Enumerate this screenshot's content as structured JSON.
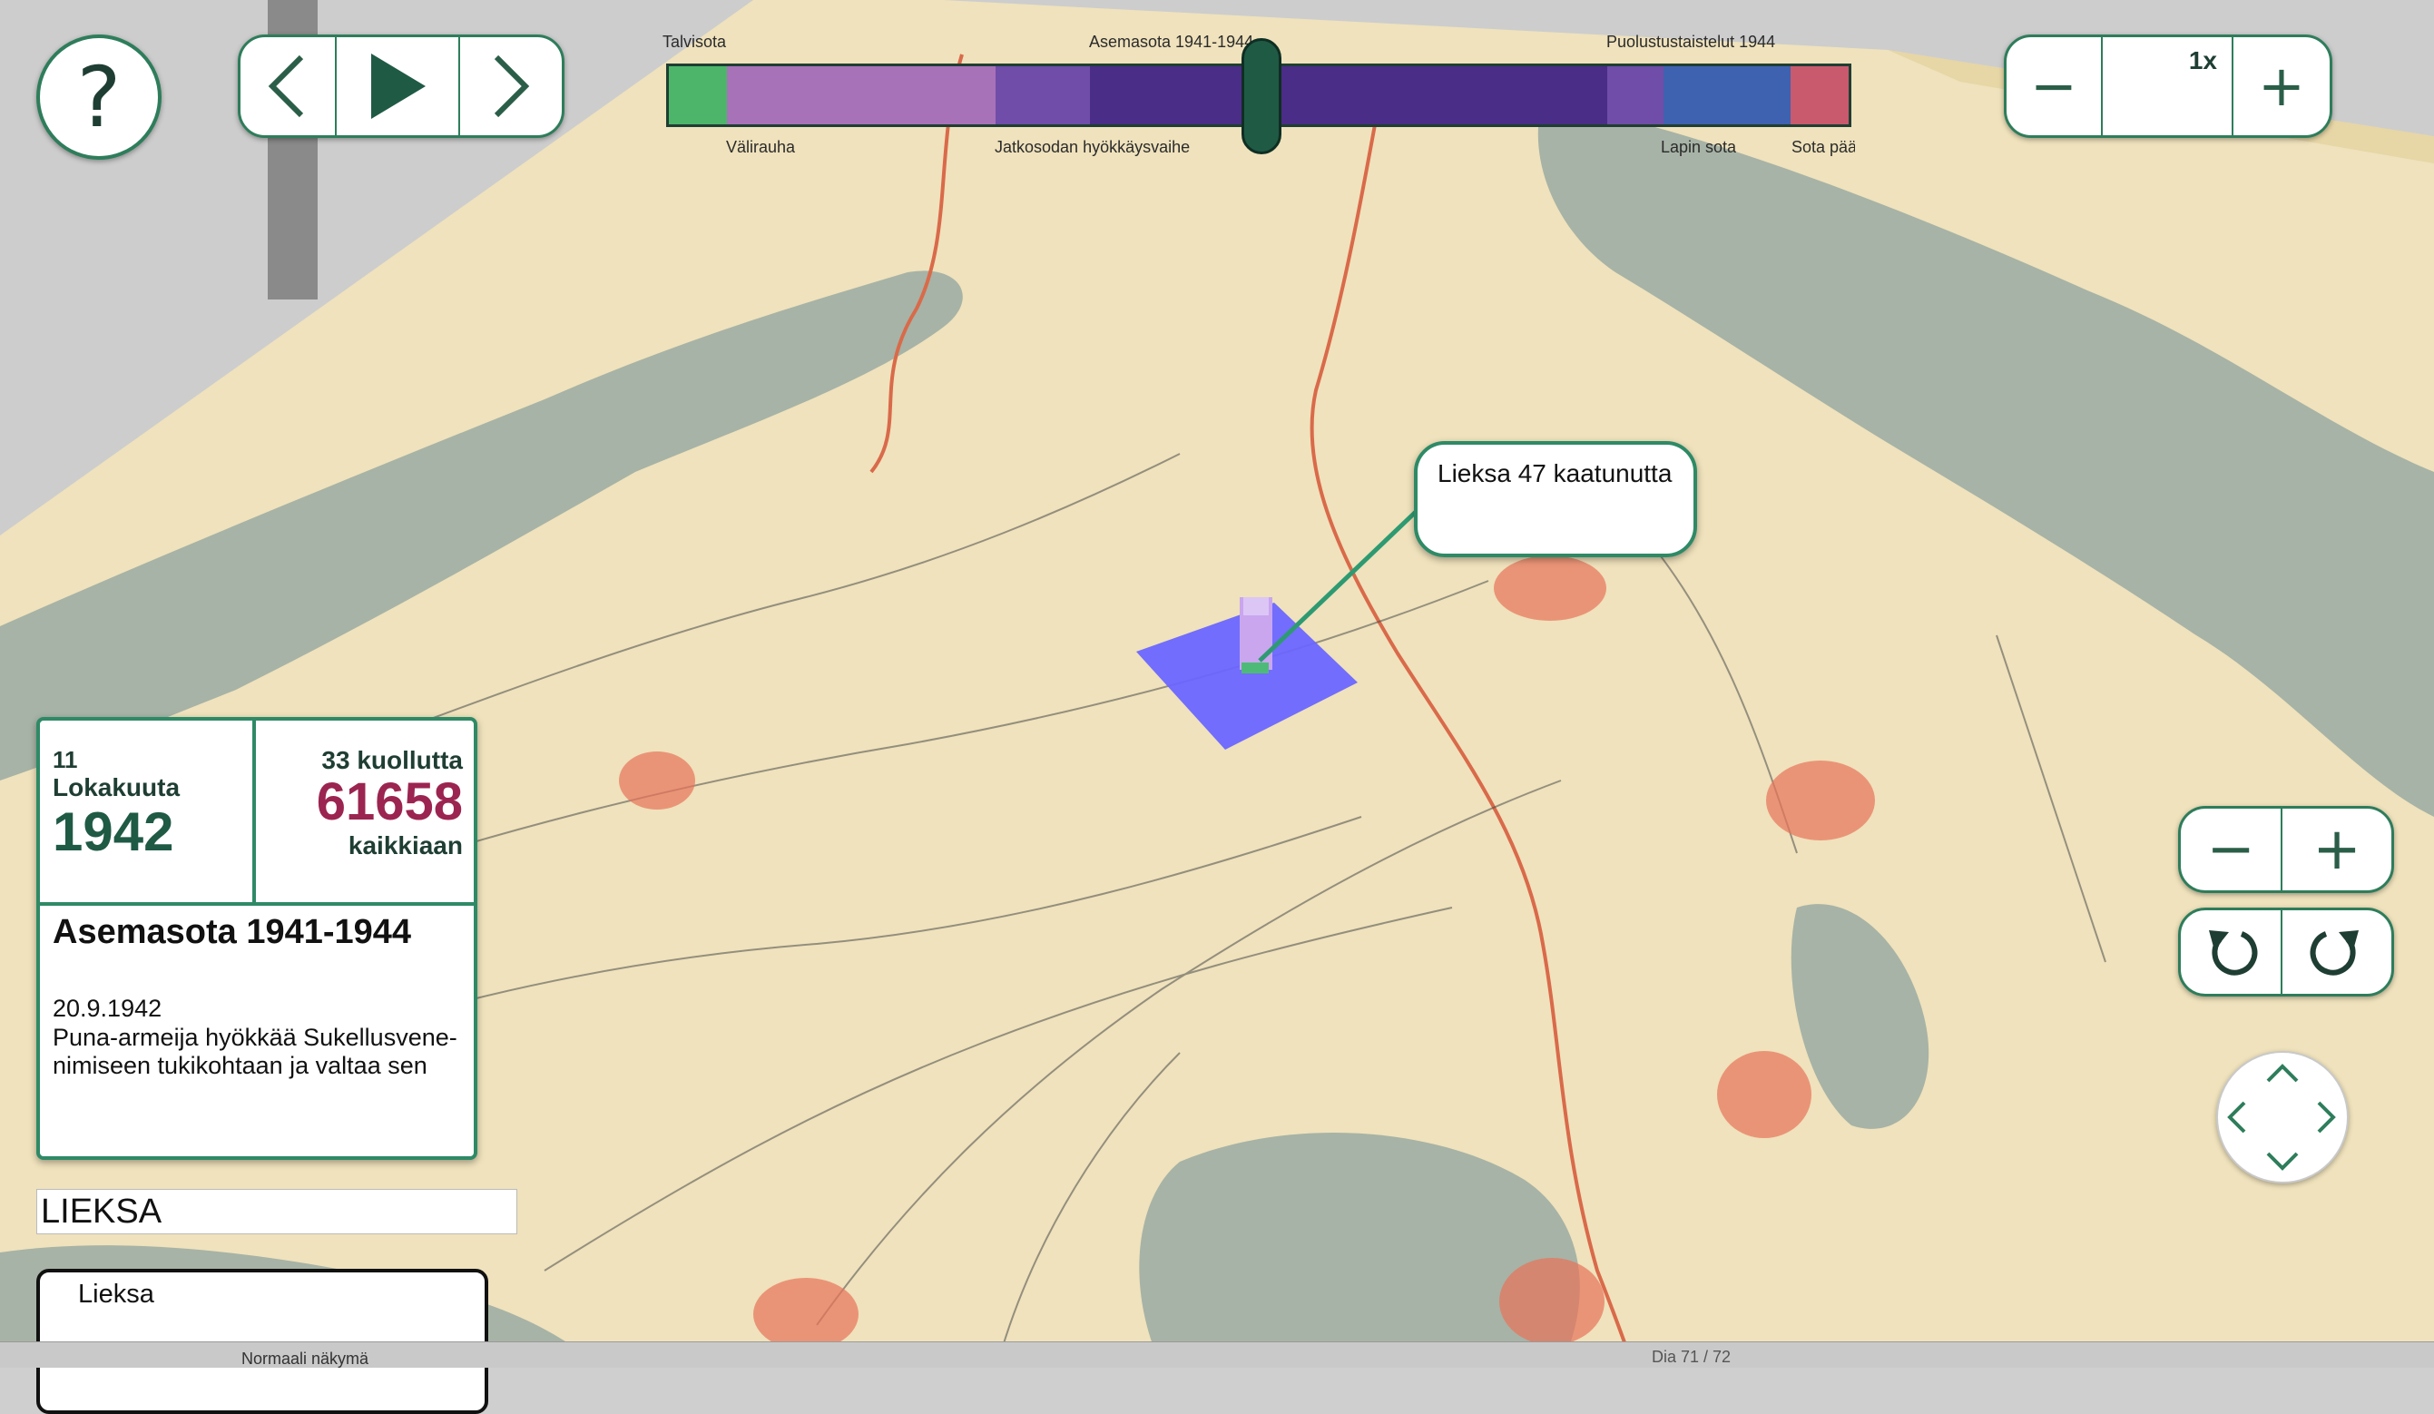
{
  "help": {
    "label": "?"
  },
  "playback": {
    "prev_icon": "chevron-left-icon",
    "play_icon": "play-icon",
    "next_icon": "chevron-right-icon"
  },
  "timeline": {
    "top_labels": [
      "Talvisota",
      "Asemasota 1941-1944",
      "Puolustustaistelut 1944"
    ],
    "bottom_labels": [
      "Välirauha",
      "Jatkosodan hyökkäysvaihe",
      "Lapin sota",
      "Sota päättyi"
    ],
    "segments": [
      {
        "color": "#4db56a"
      },
      {
        "color": "#a872b8"
      },
      {
        "color": "#6f4da8"
      },
      {
        "color": "#4a2d86"
      },
      {
        "color": "#6f4da8"
      },
      {
        "color": "#3f62b0"
      },
      {
        "color": "#c95a6e"
      }
    ]
  },
  "speed": {
    "minus": "−",
    "value": "1x",
    "plus": "+"
  },
  "zoom": {
    "minus": "−",
    "plus": "+"
  },
  "rotate": {
    "left_icon": "rotate-left-icon",
    "right_icon": "rotate-right-icon"
  },
  "callout": {
    "text": "Lieksa 47 kaatunutta"
  },
  "info": {
    "day": "11",
    "month": "Lokakuuta",
    "year": "1942",
    "deaths_today": "33 kuollutta",
    "deaths_total": "61658",
    "deaths_total_label": "kaikkiaan",
    "period_title": "Asemasota 1941-1944",
    "event_date": "20.9.1942",
    "event_text": "Puna-armeija hyökkää Sukellusvene-nimiseen tukikohtaan ja valtaa sen"
  },
  "search": {
    "value": "LIEKSA",
    "result": "Lieksa"
  },
  "taskbar": {
    "left": "Normaali näkymä",
    "right": "Dia 71 / 72"
  },
  "colors": {
    "accent": "#2e8a66",
    "accent_dark": "#1f5a45",
    "total": "#9b2550",
    "map_paper": "#f0e4c0",
    "map_water": "#a9b5a8",
    "marker": "#e8735a",
    "selection": "#6a66ff"
  }
}
